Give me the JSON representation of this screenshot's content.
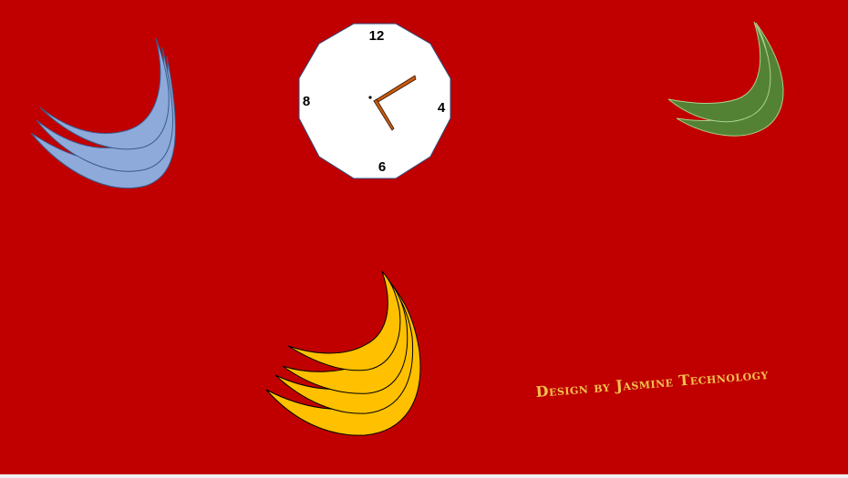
{
  "clock": {
    "numerals": {
      "top": "12",
      "right": "4",
      "bottom": "6",
      "left": "8"
    },
    "hand_color": "#c55a11",
    "face_color": "#ffffff"
  },
  "decorations": {
    "blue_moons_color": "#8eaadb",
    "green_moons_color": "#548235",
    "yellow_moons_color": "#ffc000",
    "background_color": "#c00000"
  },
  "credit": {
    "text": "Design by Jasmine Technology",
    "color": "#f2c14e"
  }
}
